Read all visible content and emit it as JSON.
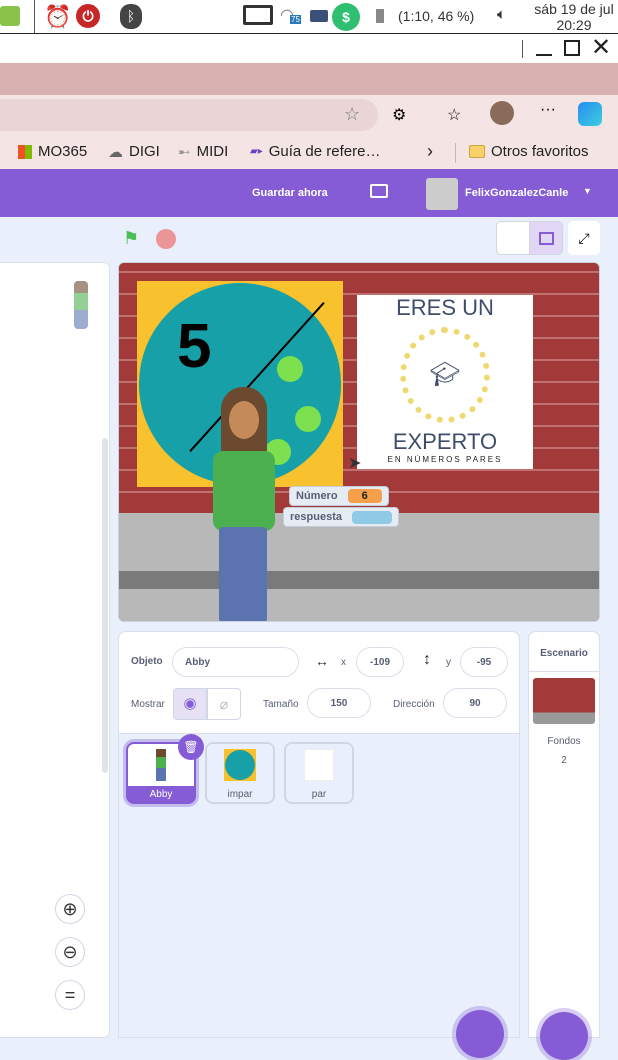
{
  "taskbar": {
    "battery": "(1:10, 46 %)",
    "date": "sáb 19 de jul",
    "time": "20:29",
    "wifi_badge": "75"
  },
  "bookmarks": [
    {
      "label": "MO365",
      "icon": "ms-logo-icon"
    },
    {
      "label": "DIGI",
      "icon": "cloud-icon"
    },
    {
      "label": "MIDI",
      "icon": "midi-icon"
    },
    {
      "label": "Guía de refere…",
      "icon": "guide-icon"
    }
  ],
  "bookmarks_other": "Otros favoritos",
  "menubar": {
    "save": "Guardar ahora",
    "user": "FelixGonzalezCanle"
  },
  "stage": {
    "left_card_number": "5",
    "right_card": {
      "line1": "ERES UN",
      "line2": "EXPERTO",
      "line3": "EN NÚMEROS PARES"
    },
    "monitors": [
      {
        "label": "Número",
        "value": "6",
        "color": "#f7a04b"
      },
      {
        "label": "respuesta",
        "value": "",
        "color": "#8ecae6"
      }
    ]
  },
  "sprite_info": {
    "object_label": "Objeto",
    "object_name": "Abby",
    "x_label": "x",
    "x": "-109",
    "y_label": "y",
    "y": "-95",
    "show_label": "Mostrar",
    "size_label": "Tamaño",
    "size": "150",
    "direction_label": "Dirección",
    "direction": "90"
  },
  "sprites": [
    {
      "name": "Abby",
      "selected": true
    },
    {
      "name": "impar",
      "selected": false
    },
    {
      "name": "par",
      "selected": false
    }
  ],
  "stage_panel": {
    "title": "Escenario",
    "backdrops_label": "Fondos",
    "backdrops_count": "2"
  },
  "colors": {
    "accent": "#855cd6",
    "brick": "#a33a3a"
  }
}
